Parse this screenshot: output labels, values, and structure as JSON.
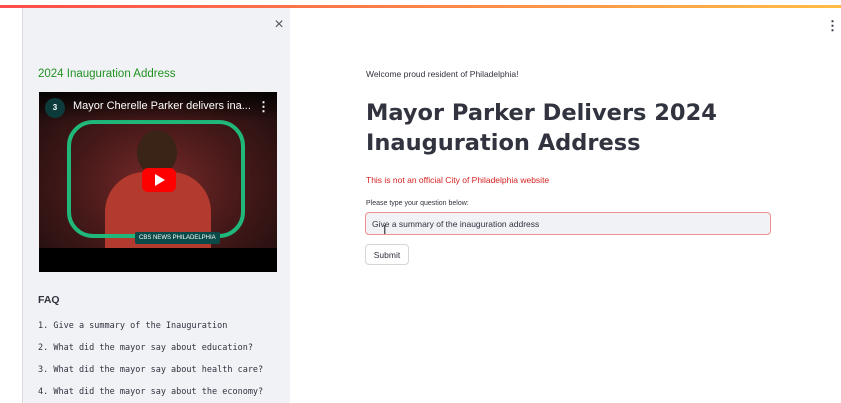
{
  "sidebar": {
    "close_glyph": "×",
    "title": "2024 Inauguration Address",
    "video": {
      "title": "Mayor Cherelle Parker delivers ina...",
      "logo_text": "3",
      "menu_glyph": "⋮",
      "badge_text": "CBS NEWS PHILADELPHIA"
    },
    "faq": {
      "title": "FAQ",
      "items": [
        "1. Give a summary of the Inauguration",
        "2. What did the mayor say about education?",
        "3. What did the mayor say about health care?",
        "4. What did the mayor say about the economy?"
      ]
    }
  },
  "main": {
    "menu_glyph": "⋮",
    "welcome": "Welcome proud resident of Philadelphia!",
    "title": "Mayor Parker Delivers 2024 Inauguration Address",
    "disclaimer": "This is not an official City of Philadelphia website",
    "question": {
      "label": "Please type your question below:",
      "value": "Give a summary of the inauguration address"
    },
    "submit_label": "Submit"
  },
  "colors": {
    "sidebar_title": "#219121",
    "disclaimer": "#d62222",
    "input_border": "#f29090",
    "sidebar_bg": "#f0f2f6",
    "video_ring": "#1fb87a",
    "play_button": "#ff0000"
  },
  "icons": {
    "close": "close-icon",
    "play": "play-icon",
    "menu": "more-vertical-icon",
    "text_cursor": "text-cursor-icon"
  }
}
